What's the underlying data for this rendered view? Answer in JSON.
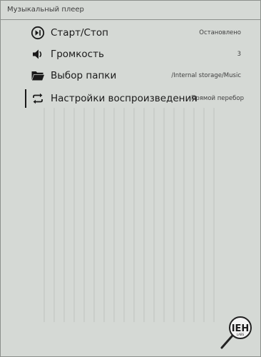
{
  "header": {
    "title": "Музыкальный плеер"
  },
  "menu": {
    "items": [
      {
        "label": "Старт/Стоп",
        "value": "Остановлено",
        "icon": "play-pause-icon"
      },
      {
        "label": "Громкость",
        "value": "3",
        "icon": "volume-icon"
      },
      {
        "label": "Выбор папки",
        "value": "/Internal storage/Music",
        "icon": "folder-icon"
      },
      {
        "label": "Настройки воспроизведения",
        "value": "Прямой перебор",
        "icon": "repeat-icon"
      }
    ],
    "selected_index": 3
  },
  "colors": {
    "screen_bg": "#d5d9d5",
    "text": "#1a1a1a",
    "secondary_text": "#3f3f3f",
    "divider": "#8a8e8a"
  }
}
